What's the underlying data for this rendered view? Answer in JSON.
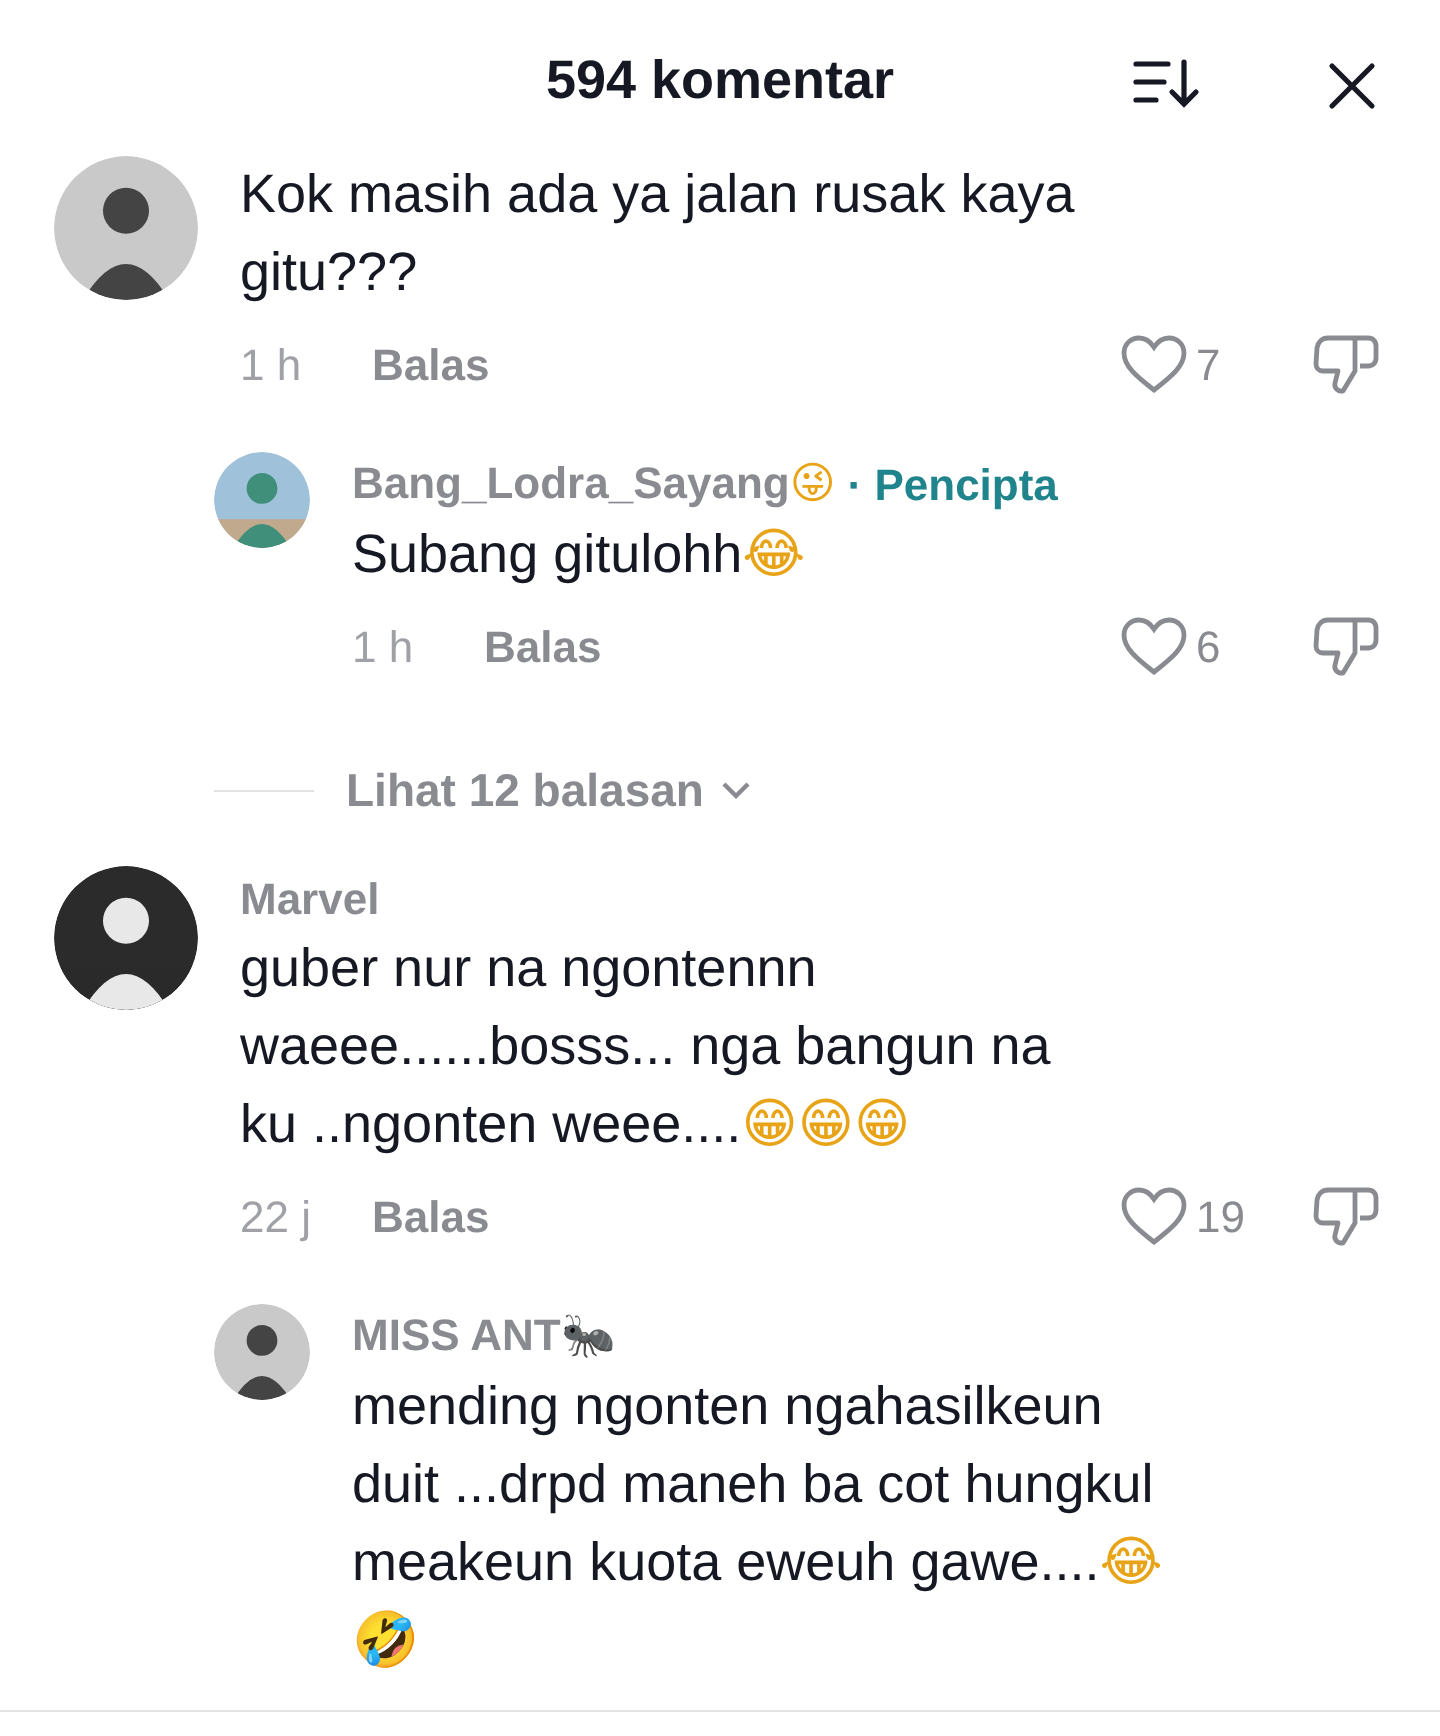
{
  "header": {
    "title": "594 komentar"
  },
  "comments": [
    {
      "kind": "comment",
      "text": "Kok masih ada ya jalan rusak kaya gitu???",
      "time": "1 h",
      "reply": "Balas",
      "likes": "7",
      "liked": false
    },
    {
      "kind": "reply",
      "author": "Bang_Lodra_Sayang😜",
      "badge": "· Pencipta",
      "text": "Subang gitulohh😂",
      "time": "1 h",
      "reply": "Balas",
      "likes": "6",
      "liked": false
    },
    {
      "kind": "more",
      "label": "Lihat 12 balasan"
    },
    {
      "kind": "comment",
      "author": "Marvel",
      "text": "guber nur na ngontennn waeee......bosss... nga bangun na ku ..ngonten weee....😁😁😁",
      "time": "22 j",
      "reply": "Balas",
      "likes": "19",
      "liked": false
    },
    {
      "kind": "reply",
      "author": "MISS ANT🐜",
      "text": "mending ngonten ngahasilkeun duit ...drpd maneh ba cot hungkul meakeun kuota eweuh gawe....😂🤣"
    }
  ]
}
